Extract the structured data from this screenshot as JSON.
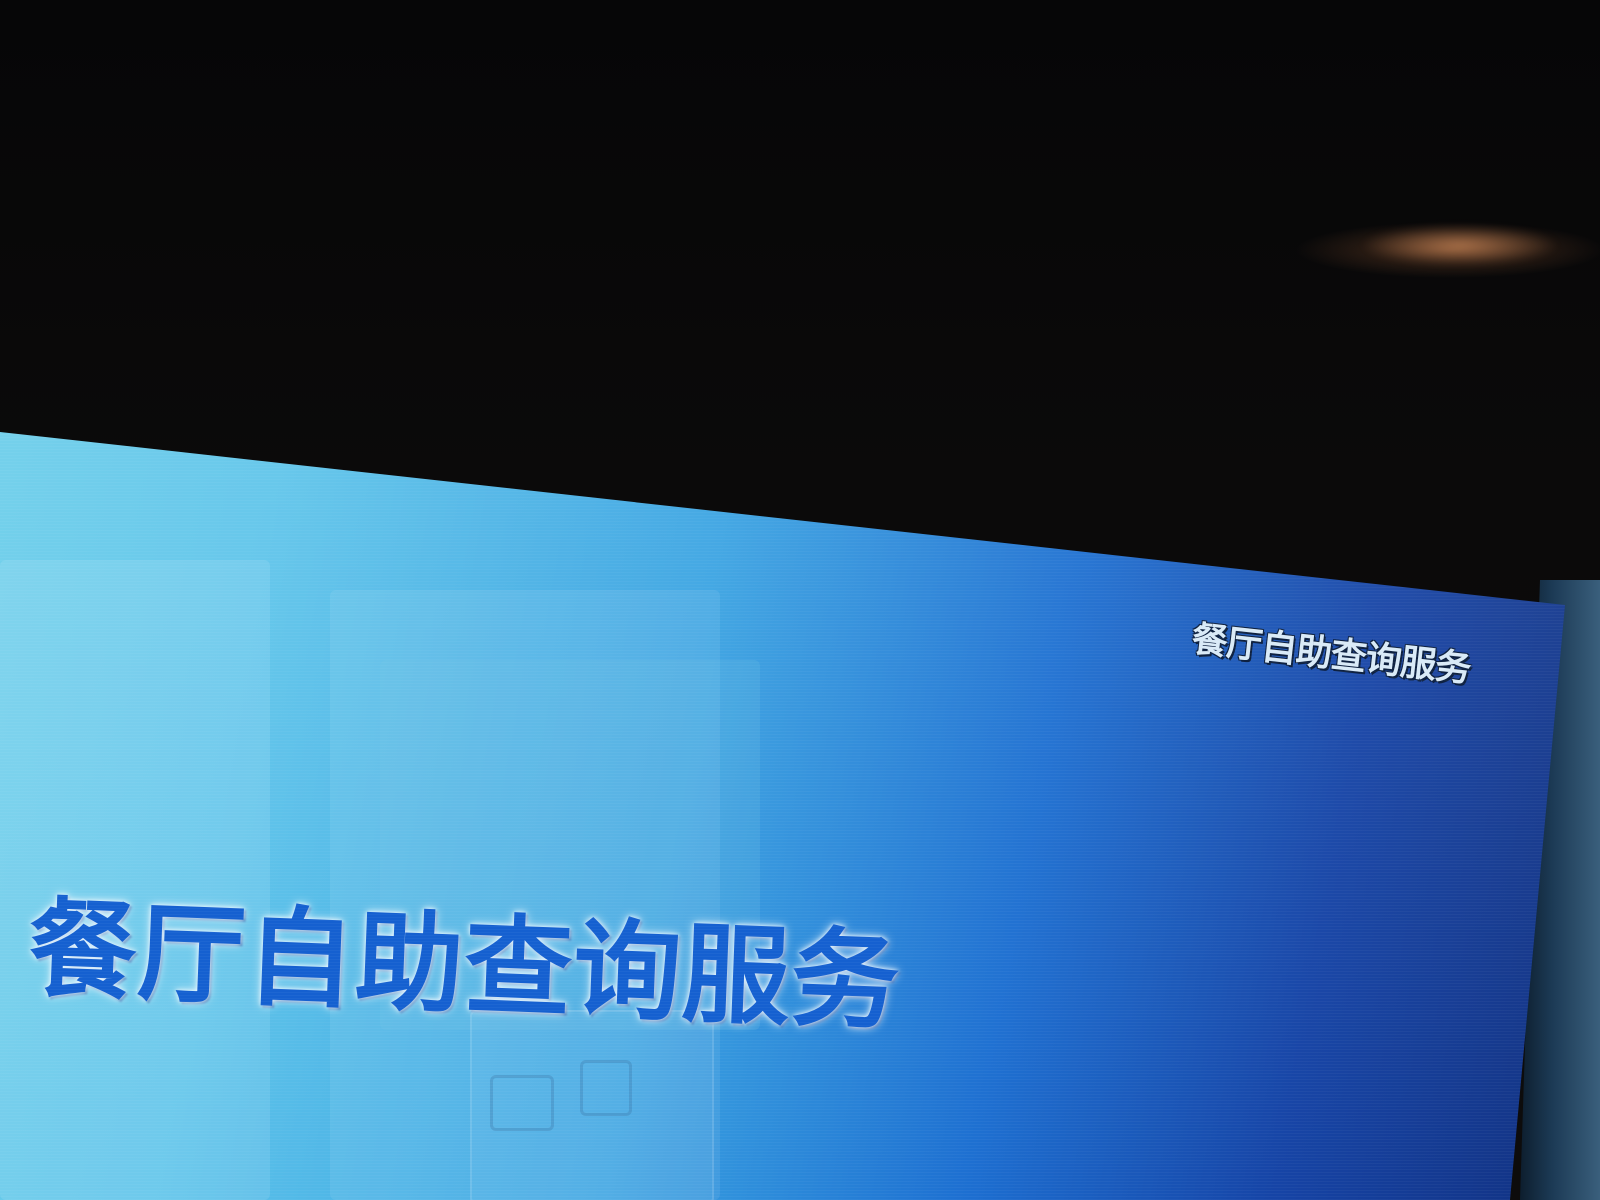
{
  "header": {
    "title": "餐厅自助查询服务"
  },
  "main": {
    "title": "餐厅自助查询服务"
  },
  "colors": {
    "screen_light": "#6fd0ea",
    "screen_mid": "#3aa3e2",
    "screen_dark": "#112f7d",
    "title_blue": "#1560d0",
    "header_text": "#d9eaf7"
  }
}
